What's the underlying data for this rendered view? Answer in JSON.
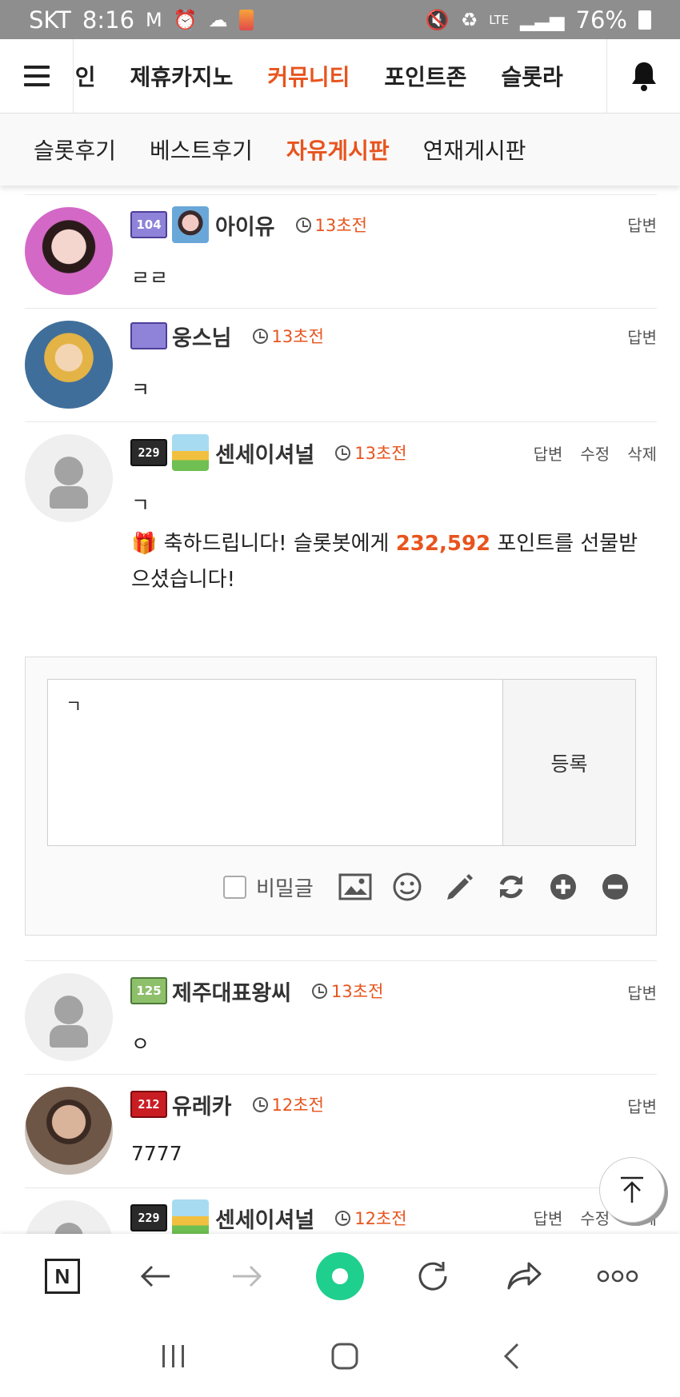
{
  "status_bar": {
    "carrier": "SKT",
    "time": "8:16",
    "network": "LTE",
    "battery": "76%"
  },
  "top_nav": {
    "tabs": [
      {
        "label": "메인"
      },
      {
        "label": "제휴카지노"
      },
      {
        "label": "커뮤니티",
        "active": true
      },
      {
        "label": "포인트존"
      },
      {
        "label": "슬롯라"
      }
    ]
  },
  "sub_nav": {
    "tabs": [
      {
        "label": "슬롯후기"
      },
      {
        "label": "베스트후기"
      },
      {
        "label": "자유게시판",
        "active": true
      },
      {
        "label": "연재게시판"
      }
    ]
  },
  "accent_color": "#e8541e",
  "comments": [
    {
      "nick": "아이유",
      "level": "104",
      "time": "13초전",
      "text": "ㄹㄹ",
      "actions": [
        "답변"
      ]
    },
    {
      "nick": "웅스님",
      "level": "",
      "time": "13초전",
      "text": "ㅋ",
      "actions": [
        "답변"
      ]
    },
    {
      "nick": "센세이셔널",
      "level": "229",
      "time": "13초전",
      "text": "ㄱ",
      "actions": [
        "답변",
        "수정",
        "삭제"
      ],
      "gift": {
        "prefix": "축하드립니다! 슬롯봇에게 ",
        "amount": "232,592",
        "suffix": " 포인트를 선물받으셨습니다!"
      }
    },
    {
      "nick": "제주대표왕씨",
      "level": "125",
      "time": "13초전",
      "text": "ㅇ",
      "actions": [
        "답변"
      ]
    },
    {
      "nick": "유레카",
      "level": "212",
      "time": "12초전",
      "text": "7777",
      "actions": [
        "답변"
      ]
    },
    {
      "nick": "센세이셔널",
      "level": "229",
      "time": "12초전",
      "text": "",
      "actions": [
        "답변",
        "수정",
        "삭제"
      ]
    }
  ],
  "reply_form": {
    "value": "ㄱ",
    "submit_label": "등록",
    "secret_label": "비밀글",
    "tools": [
      "image-icon",
      "emoji-icon",
      "pencil-icon",
      "refresh-icon",
      "plus-circle-icon",
      "minus-circle-icon"
    ]
  },
  "browser_bar": {
    "icons": [
      "naver-n-icon",
      "back-arrow-icon",
      "forward-arrow-icon",
      "green-dot-icon",
      "reload-icon",
      "share-icon",
      "more-icon"
    ]
  }
}
